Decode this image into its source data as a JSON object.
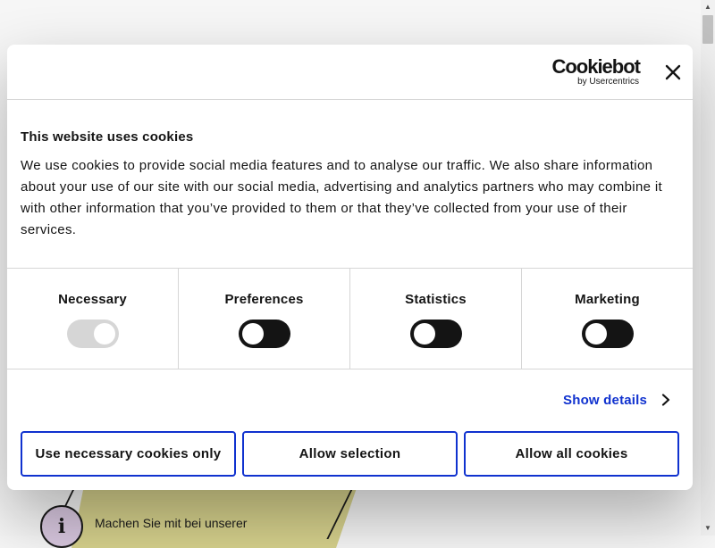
{
  "page": {
    "promo_text": "Machen Sie mit bei unserer",
    "info_icon_glyph": "i"
  },
  "dialog": {
    "logo": {
      "main": "Cookiebot",
      "sub": "by Usercentrics"
    },
    "close_icon": "close-icon",
    "title": "This website uses cookies",
    "description": "We use cookies to provide social media features and to analyse our traffic. We also share information about your use of our site with our social media, advertising and analytics partners who may combine it with other information that you’ve provided to them or that they’ve collected from your use of their services.",
    "categories": [
      {
        "label": "Necessary",
        "enabled": true,
        "locked": true
      },
      {
        "label": "Preferences",
        "enabled": false,
        "locked": false
      },
      {
        "label": "Statistics",
        "enabled": false,
        "locked": false
      },
      {
        "label": "Marketing",
        "enabled": false,
        "locked": false
      }
    ],
    "show_details": "Show details",
    "buttons": {
      "necessary": "Use necessary cookies only",
      "selection": "Allow selection",
      "all": "Allow all cookies"
    }
  },
  "colors": {
    "accent": "#1032cf",
    "toggle_on": "#141414",
    "toggle_disabled": "#d6d6d6",
    "promo_banner": "#d7d28d",
    "info_icon_bg": "#d9c8e0"
  }
}
